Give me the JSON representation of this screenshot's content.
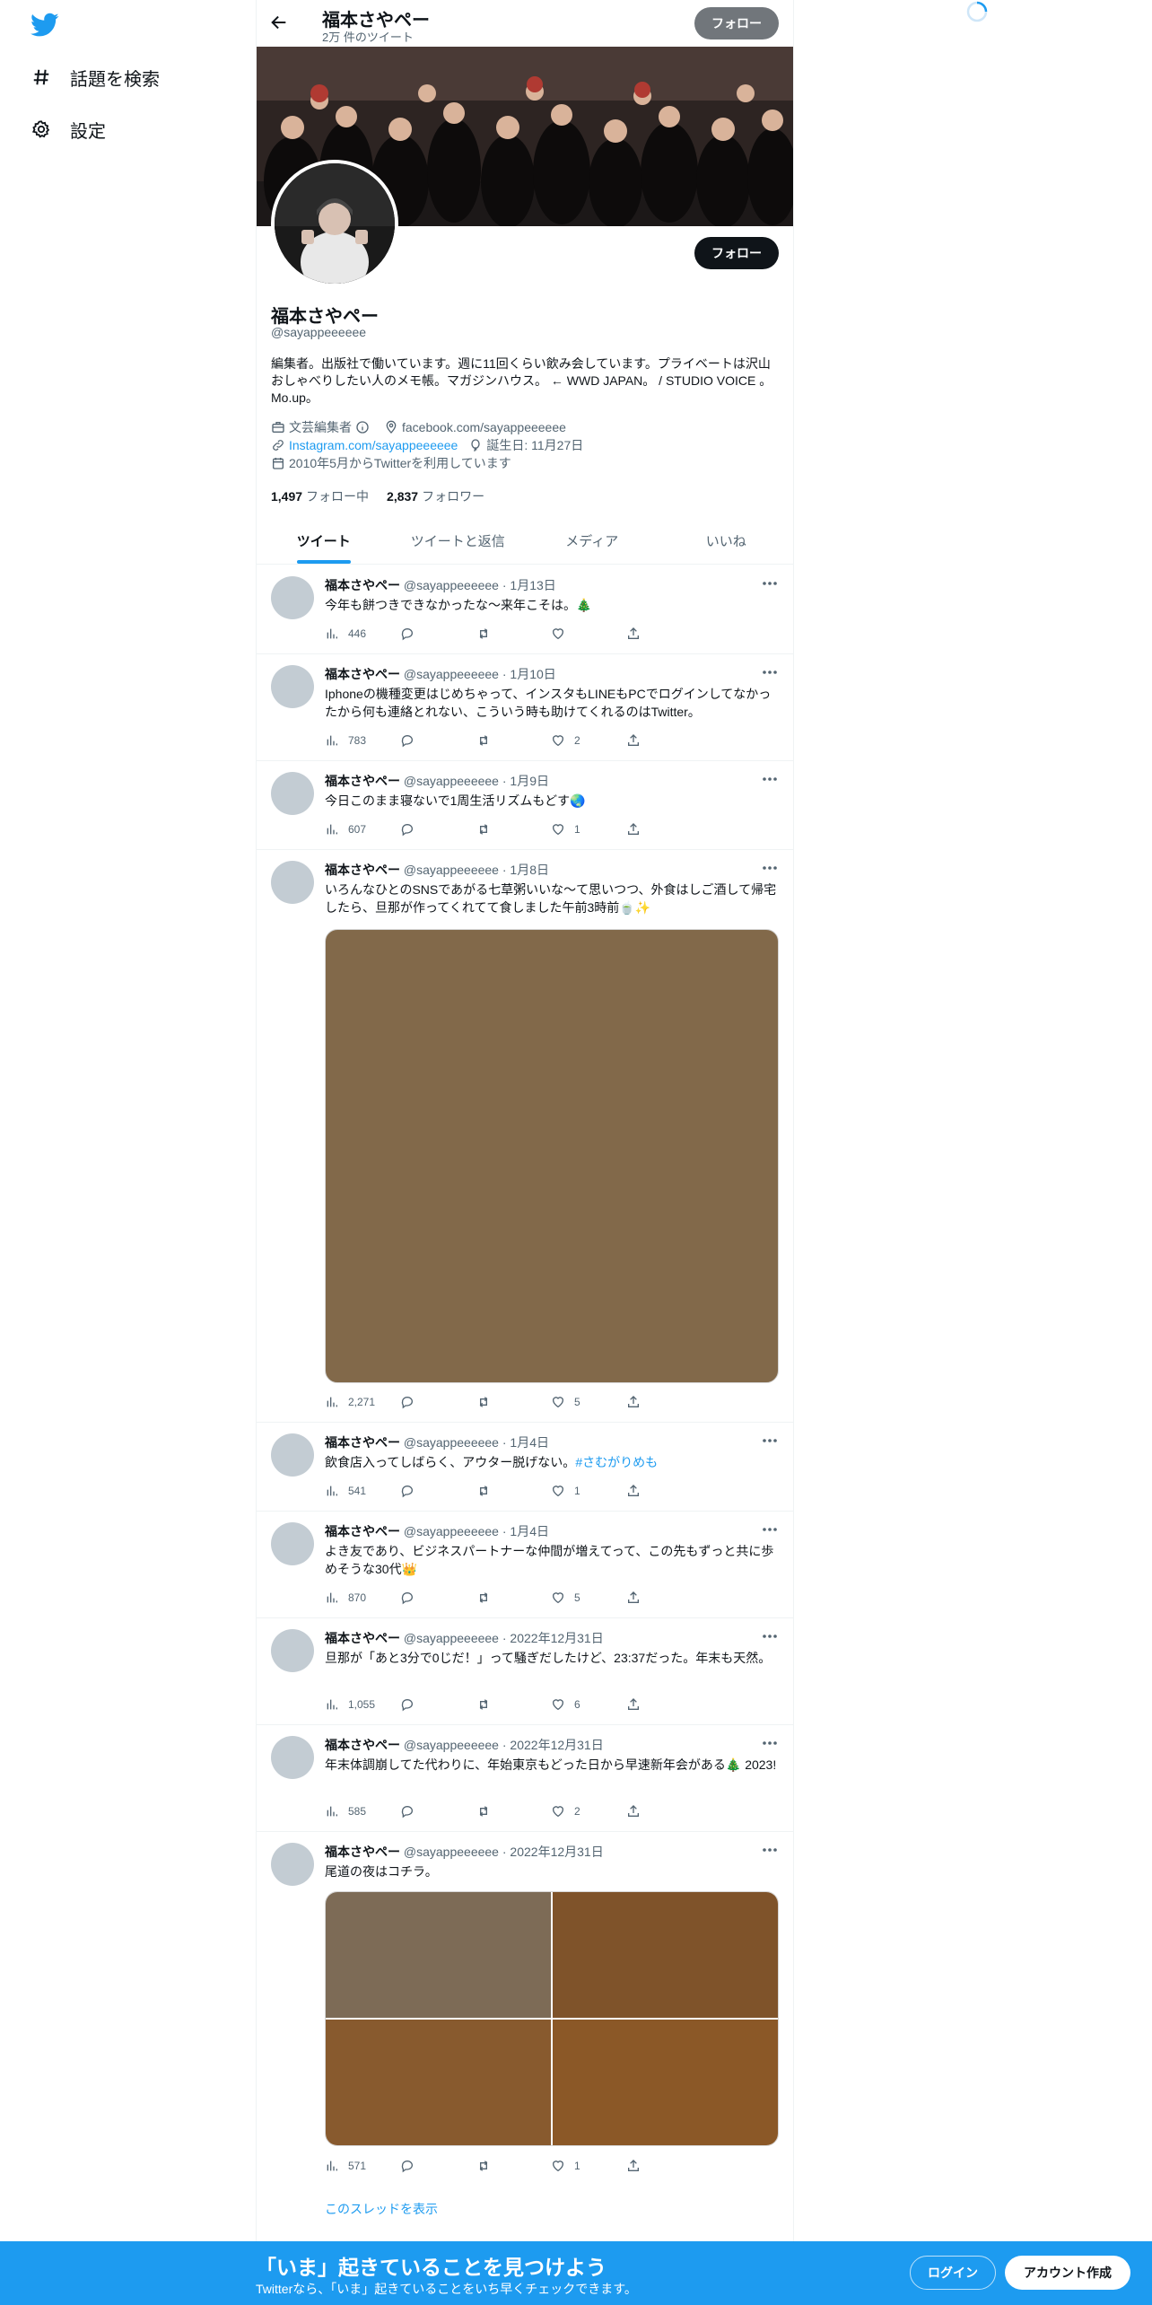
{
  "nav": {
    "explore_label": "話題を検索",
    "settings_label": "設定"
  },
  "header": {
    "name": "福本さやペー",
    "tweet_count": "2万 件のツイート",
    "follow_label": "フォロー"
  },
  "profile": {
    "name": "福本さやペー",
    "handle": "@sayappeeeeee",
    "bio": "編集者。出版社で働いています。週に11回くらい飲み会しています。プライベートは沢山おしゃべりしたい人のメモ帳。マガジンハウス。 ← WWD JAPAN。 / STUDIO VOICE 。Mo.up。",
    "category": "文芸編集者",
    "location": "facebook.com/sayappeeeeee",
    "website": "Instagram.com/sayappeeeeee",
    "birthday": "誕生日: 11月27日",
    "joined": "2010年5月からTwitterを利用しています",
    "following_count": "1,497",
    "following_label": "フォロー中",
    "followers_count": "2,837",
    "followers_label": "フォロワー",
    "follow_label": "フォロー"
  },
  "tabs": [
    "ツイート",
    "ツイートと返信",
    "メディア",
    "いいね"
  ],
  "tweets": [
    {
      "name": "福本さやペー",
      "handle": "@sayappeeeeee",
      "date": "1月13日",
      "text": "今年も餅つきできなかったな〜来年こそは。🎄",
      "views": "446",
      "likes": ""
    },
    {
      "name": "福本さやペー",
      "handle": "@sayappeeeeee",
      "date": "1月10日",
      "text": "Iphoneの機種変更はじめちゃって、インスタもLINEもPCでログインしてなかったから何も連絡とれない、こういう時も助けてくれるのはTwitter。",
      "views": "783",
      "likes": "2"
    },
    {
      "name": "福本さやペー",
      "handle": "@sayappeeeeee",
      "date": "1月9日",
      "text": "今日このまま寝ないで1周生活リズムもどす🌏",
      "views": "607",
      "likes": "1"
    },
    {
      "name": "福本さやペー",
      "handle": "@sayappeeeeee",
      "date": "1月8日",
      "text": "いろんなひとのSNSであがる七草粥いいな〜て思いつつ、外食はしご酒して帰宅したら、旦那が作ってくれてて食しました午前3時前🍵✨",
      "views": "2,271",
      "likes": "5"
    },
    {
      "name": "福本さやペー",
      "handle": "@sayappeeeeee",
      "date": "1月4日",
      "text": "飲食店入ってしばらく、アウター脱げない。",
      "hashtag": "#さむがりめも",
      "views": "541",
      "likes": "1"
    },
    {
      "name": "福本さやペー",
      "handle": "@sayappeeeeee",
      "date": "1月4日",
      "text": "よき友であり、ビジネスパートナーな仲間が増えてって、この先もずっと共に歩めそうな30代👑",
      "views": "870",
      "likes": "5"
    },
    {
      "name": "福本さやペー",
      "handle": "@sayappeeeeee",
      "date": "2022年12月31日",
      "text": "旦那が「あと3分で0じだ！」って騒ぎだしたけど、23:37だった。年末も天然。",
      "views": "1,055",
      "likes": "6"
    },
    {
      "name": "福本さやペー",
      "handle": "@sayappeeeeee",
      "date": "2022年12月31日",
      "text": "年末体調崩してた代わりに、年始東京もどった日から早速新年会がある🎄 2023!",
      "views": "585",
      "likes": "2"
    },
    {
      "name": "福本さやペー",
      "handle": "@sayappeeeeee",
      "date": "2022年12月31日",
      "text": "尾道の夜はコチラ。",
      "views": "571",
      "likes": "1",
      "thread_label": "このスレッドを表示"
    }
  ],
  "bottom_banner": {
    "title": "「いま」起きていることを見つけよう",
    "subtitle": "Twitterなら、「いま」起きていることをいち早くチェックできます。",
    "login_label": "ログイン",
    "signup_label": "アカウント作成"
  },
  "colors": {
    "accent": "#1d9bf0",
    "bottom_banner": "#1d9bf0",
    "media_single": "#82694a",
    "media_grid": [
      "#7d6b56",
      "#7f532a",
      "#885a2e",
      "#8b5827"
    ]
  }
}
